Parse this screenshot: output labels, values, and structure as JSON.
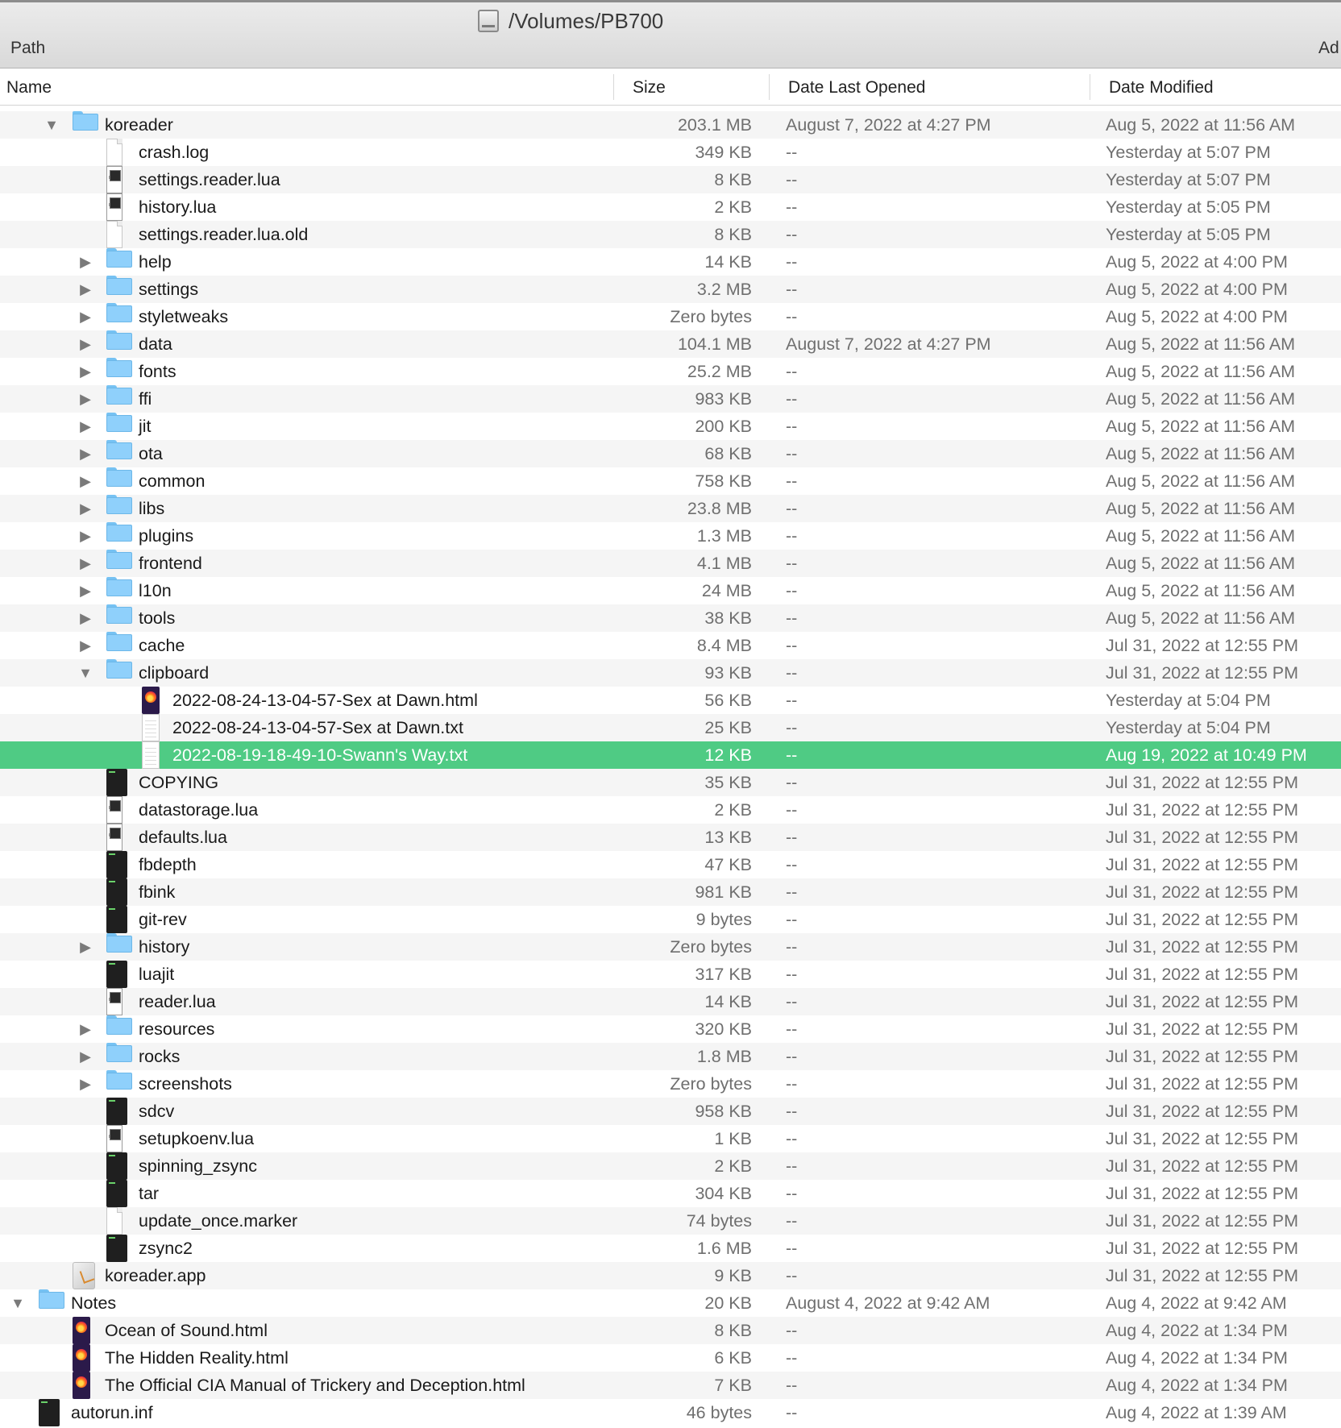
{
  "window": {
    "title": "/Volumes/PB700",
    "path_label": "Path",
    "add_label": "Ad"
  },
  "columns": {
    "name": "Name",
    "size": "Size",
    "opened": "Date Last Opened",
    "modified": "Date Modified"
  },
  "rows": [
    {
      "name": "koreader",
      "size": "203.1 MB",
      "opened": "August 7, 2022 at 4:27 PM",
      "modified": "Aug 5, 2022 at 11:56 AM",
      "level": 1,
      "icon": "folder-icon",
      "disclosure": "expanded"
    },
    {
      "name": "crash.log",
      "size": "349 KB",
      "opened": "--",
      "modified": "Yesterday at 5:07 PM",
      "level": 2,
      "icon": "document-icon",
      "disclosure": "none"
    },
    {
      "name": "settings.reader.lua",
      "size": "8 KB",
      "opened": "--",
      "modified": "Yesterday at 5:07 PM",
      "level": 2,
      "icon": "lua-file-icon",
      "disclosure": "none"
    },
    {
      "name": "history.lua",
      "size": "2 KB",
      "opened": "--",
      "modified": "Yesterday at 5:05 PM",
      "level": 2,
      "icon": "lua-file-icon",
      "disclosure": "none"
    },
    {
      "name": "settings.reader.lua.old",
      "size": "8 KB",
      "opened": "--",
      "modified": "Yesterday at 5:05 PM",
      "level": 2,
      "icon": "document-icon",
      "disclosure": "none"
    },
    {
      "name": "help",
      "size": "14 KB",
      "opened": "--",
      "modified": "Aug 5, 2022 at 4:00 PM",
      "level": 2,
      "icon": "folder-icon",
      "disclosure": "collapsed"
    },
    {
      "name": "settings",
      "size": "3.2 MB",
      "opened": "--",
      "modified": "Aug 5, 2022 at 4:00 PM",
      "level": 2,
      "icon": "folder-icon",
      "disclosure": "collapsed"
    },
    {
      "name": "styletweaks",
      "size": "Zero bytes",
      "opened": "--",
      "modified": "Aug 5, 2022 at 4:00 PM",
      "level": 2,
      "icon": "folder-icon",
      "disclosure": "collapsed"
    },
    {
      "name": "data",
      "size": "104.1 MB",
      "opened": "August 7, 2022 at 4:27 PM",
      "modified": "Aug 5, 2022 at 11:56 AM",
      "level": 2,
      "icon": "folder-icon",
      "disclosure": "collapsed"
    },
    {
      "name": "fonts",
      "size": "25.2 MB",
      "opened": "--",
      "modified": "Aug 5, 2022 at 11:56 AM",
      "level": 2,
      "icon": "folder-icon",
      "disclosure": "collapsed"
    },
    {
      "name": "ffi",
      "size": "983 KB",
      "opened": "--",
      "modified": "Aug 5, 2022 at 11:56 AM",
      "level": 2,
      "icon": "folder-icon",
      "disclosure": "collapsed"
    },
    {
      "name": "jit",
      "size": "200 KB",
      "opened": "--",
      "modified": "Aug 5, 2022 at 11:56 AM",
      "level": 2,
      "icon": "folder-icon",
      "disclosure": "collapsed"
    },
    {
      "name": "ota",
      "size": "68 KB",
      "opened": "--",
      "modified": "Aug 5, 2022 at 11:56 AM",
      "level": 2,
      "icon": "folder-icon",
      "disclosure": "collapsed"
    },
    {
      "name": "common",
      "size": "758 KB",
      "opened": "--",
      "modified": "Aug 5, 2022 at 11:56 AM",
      "level": 2,
      "icon": "folder-icon",
      "disclosure": "collapsed"
    },
    {
      "name": "libs",
      "size": "23.8 MB",
      "opened": "--",
      "modified": "Aug 5, 2022 at 11:56 AM",
      "level": 2,
      "icon": "folder-icon",
      "disclosure": "collapsed"
    },
    {
      "name": "plugins",
      "size": "1.3 MB",
      "opened": "--",
      "modified": "Aug 5, 2022 at 11:56 AM",
      "level": 2,
      "icon": "folder-icon",
      "disclosure": "collapsed"
    },
    {
      "name": "frontend",
      "size": "4.1 MB",
      "opened": "--",
      "modified": "Aug 5, 2022 at 11:56 AM",
      "level": 2,
      "icon": "folder-icon",
      "disclosure": "collapsed"
    },
    {
      "name": "l10n",
      "size": "24 MB",
      "opened": "--",
      "modified": "Aug 5, 2022 at 11:56 AM",
      "level": 2,
      "icon": "folder-icon",
      "disclosure": "collapsed"
    },
    {
      "name": "tools",
      "size": "38 KB",
      "opened": "--",
      "modified": "Aug 5, 2022 at 11:56 AM",
      "level": 2,
      "icon": "folder-icon",
      "disclosure": "collapsed"
    },
    {
      "name": "cache",
      "size": "8.4 MB",
      "opened": "--",
      "modified": "Jul 31, 2022 at 12:55 PM",
      "level": 2,
      "icon": "folder-icon",
      "disclosure": "collapsed"
    },
    {
      "name": "clipboard",
      "size": "93 KB",
      "opened": "--",
      "modified": "Jul 31, 2022 at 12:55 PM",
      "level": 2,
      "icon": "folder-icon",
      "disclosure": "expanded"
    },
    {
      "name": "2022-08-24-13-04-57-Sex at Dawn.html",
      "size": "56 KB",
      "opened": "--",
      "modified": "Yesterday at 5:04 PM",
      "level": 3,
      "icon": "html-file-icon",
      "disclosure": "none"
    },
    {
      "name": "2022-08-24-13-04-57-Sex at Dawn.txt",
      "size": "25 KB",
      "opened": "--",
      "modified": "Yesterday at 5:04 PM",
      "level": 3,
      "icon": "text-file-icon",
      "disclosure": "none"
    },
    {
      "name": "2022-08-19-18-49-10-Swann's Way.txt",
      "size": "12 KB",
      "opened": "--",
      "modified": "Aug 19, 2022 at 10:49 PM",
      "level": 3,
      "icon": "text-file-icon",
      "disclosure": "none",
      "selected": true
    },
    {
      "name": "COPYING",
      "size": "35 KB",
      "opened": "--",
      "modified": "Jul 31, 2022 at 12:55 PM",
      "level": 2,
      "icon": "executable-icon",
      "disclosure": "none"
    },
    {
      "name": "datastorage.lua",
      "size": "2 KB",
      "opened": "--",
      "modified": "Jul 31, 2022 at 12:55 PM",
      "level": 2,
      "icon": "lua-file-icon",
      "disclosure": "none"
    },
    {
      "name": "defaults.lua",
      "size": "13 KB",
      "opened": "--",
      "modified": "Jul 31, 2022 at 12:55 PM",
      "level": 2,
      "icon": "lua-file-icon",
      "disclosure": "none"
    },
    {
      "name": "fbdepth",
      "size": "47 KB",
      "opened": "--",
      "modified": "Jul 31, 2022 at 12:55 PM",
      "level": 2,
      "icon": "executable-icon",
      "disclosure": "none"
    },
    {
      "name": "fbink",
      "size": "981 KB",
      "opened": "--",
      "modified": "Jul 31, 2022 at 12:55 PM",
      "level": 2,
      "icon": "executable-icon",
      "disclosure": "none"
    },
    {
      "name": "git-rev",
      "size": "9 bytes",
      "opened": "--",
      "modified": "Jul 31, 2022 at 12:55 PM",
      "level": 2,
      "icon": "executable-icon",
      "disclosure": "none"
    },
    {
      "name": "history",
      "size": "Zero bytes",
      "opened": "--",
      "modified": "Jul 31, 2022 at 12:55 PM",
      "level": 2,
      "icon": "folder-icon",
      "disclosure": "collapsed"
    },
    {
      "name": "luajit",
      "size": "317 KB",
      "opened": "--",
      "modified": "Jul 31, 2022 at 12:55 PM",
      "level": 2,
      "icon": "executable-icon",
      "disclosure": "none"
    },
    {
      "name": "reader.lua",
      "size": "14 KB",
      "opened": "--",
      "modified": "Jul 31, 2022 at 12:55 PM",
      "level": 2,
      "icon": "lua-file-icon",
      "disclosure": "none"
    },
    {
      "name": "resources",
      "size": "320 KB",
      "opened": "--",
      "modified": "Jul 31, 2022 at 12:55 PM",
      "level": 2,
      "icon": "folder-icon",
      "disclosure": "collapsed"
    },
    {
      "name": "rocks",
      "size": "1.8 MB",
      "opened": "--",
      "modified": "Jul 31, 2022 at 12:55 PM",
      "level": 2,
      "icon": "folder-icon",
      "disclosure": "collapsed"
    },
    {
      "name": "screenshots",
      "size": "Zero bytes",
      "opened": "--",
      "modified": "Jul 31, 2022 at 12:55 PM",
      "level": 2,
      "icon": "folder-icon",
      "disclosure": "collapsed"
    },
    {
      "name": "sdcv",
      "size": "958 KB",
      "opened": "--",
      "modified": "Jul 31, 2022 at 12:55 PM",
      "level": 2,
      "icon": "executable-icon",
      "disclosure": "none"
    },
    {
      "name": "setupkoenv.lua",
      "size": "1 KB",
      "opened": "--",
      "modified": "Jul 31, 2022 at 12:55 PM",
      "level": 2,
      "icon": "lua-file-icon",
      "disclosure": "none"
    },
    {
      "name": "spinning_zsync",
      "size": "2 KB",
      "opened": "--",
      "modified": "Jul 31, 2022 at 12:55 PM",
      "level": 2,
      "icon": "executable-icon",
      "disclosure": "none"
    },
    {
      "name": "tar",
      "size": "304 KB",
      "opened": "--",
      "modified": "Jul 31, 2022 at 12:55 PM",
      "level": 2,
      "icon": "executable-icon",
      "disclosure": "none"
    },
    {
      "name": "update_once.marker",
      "size": "74 bytes",
      "opened": "--",
      "modified": "Jul 31, 2022 at 12:55 PM",
      "level": 2,
      "icon": "document-icon",
      "disclosure": "none"
    },
    {
      "name": "zsync2",
      "size": "1.6 MB",
      "opened": "--",
      "modified": "Jul 31, 2022 at 12:55 PM",
      "level": 2,
      "icon": "executable-icon",
      "disclosure": "none"
    },
    {
      "name": "koreader.app",
      "size": "9 KB",
      "opened": "--",
      "modified": "Jul 31, 2022 at 12:55 PM",
      "level": 1,
      "icon": "app-icon",
      "disclosure": "none"
    },
    {
      "name": "Notes",
      "size": "20 KB",
      "opened": "August 4, 2022 at 9:42 AM",
      "modified": "Aug 4, 2022 at 9:42 AM",
      "level": 0,
      "icon": "folder-icon",
      "disclosure": "expanded"
    },
    {
      "name": "Ocean of Sound.html",
      "size": "8 KB",
      "opened": "--",
      "modified": "Aug 4, 2022 at 1:34 PM",
      "level": 1,
      "icon": "html-file-icon",
      "disclosure": "none"
    },
    {
      "name": "The Hidden Reality.html",
      "size": "6 KB",
      "opened": "--",
      "modified": "Aug 4, 2022 at 1:34 PM",
      "level": 1,
      "icon": "html-file-icon",
      "disclosure": "none"
    },
    {
      "name": "The Official CIA Manual of Trickery and Deception.html",
      "size": "7 KB",
      "opened": "--",
      "modified": "Aug 4, 2022 at 1:34 PM",
      "level": 1,
      "icon": "html-file-icon",
      "disclosure": "none"
    },
    {
      "name": "autorun.inf",
      "size": "46 bytes",
      "opened": "--",
      "modified": "Aug 4, 2022 at 1:39 AM",
      "level": 0,
      "icon": "executable-icon",
      "disclosure": "none"
    }
  ]
}
